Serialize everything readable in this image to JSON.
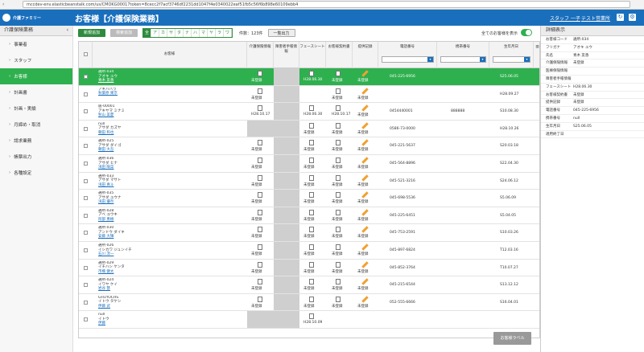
{
  "browser": {
    "url": "mccdev-env.elasticbeanstalk.com/us/CMOKG00017token=8cecc2f7acf3746df2231dd1047f4e0340022eaf51fb5c56f6b898e60109ebb4"
  },
  "header": {
    "logo_text": "介護ファミリー",
    "title": "お客様【介護保険業務】",
    "user": "スタッフ 一子",
    "store": "テスト営業所"
  },
  "sidebar": {
    "title": "介護保険業務",
    "items": [
      {
        "label": "事業者",
        "active": false
      },
      {
        "label": "スタッフ",
        "active": false
      },
      {
        "label": "お客様",
        "active": true
      },
      {
        "label": "計画書",
        "active": false
      },
      {
        "label": "計画・実績",
        "active": false
      },
      {
        "label": "月締め・取消",
        "active": false
      },
      {
        "label": "請求業務",
        "active": false
      },
      {
        "label": "帳票出力",
        "active": false
      },
      {
        "label": "各種設定",
        "active": false
      }
    ]
  },
  "toolbar": {
    "new_label": "新規追加",
    "add_label": "検索追加",
    "kana": [
      "全",
      "ア",
      "カ",
      "サ",
      "タ",
      "ナ",
      "ハ",
      "マ",
      "ヤ",
      "ラ",
      "ワ"
    ],
    "count": "件数：123件",
    "list_label": "一覧出力",
    "all_toggle_label": "全てのお客様を表示"
  },
  "columns": {
    "name": "お客様",
    "care_info": "介護保険情報",
    "welfare": "障害者手帳情報",
    "facesheet": "フェースシート",
    "contract": "お客様契約書",
    "proc": "提供記録",
    "phone": "電話番号",
    "mobile": "携帯番号",
    "birth": "生年月日",
    "end": "適用終了日"
  },
  "rows": [
    {
      "id": "通所-034",
      "kana": "アオキ ユウ",
      "name": "青木 友香",
      "care": "未登録",
      "fs": "H28.06.30",
      "ct": "未登録",
      "pr": "未登録",
      "phone": "045-225-6956",
      "mobile": "",
      "birth": "S25.06.05",
      "hl": true
    },
    {
      "id": "",
      "kana": "アキハバラ",
      "name": "秋葉原 東京",
      "care": "未登録",
      "fs": "",
      "ct": "未登録",
      "pr": "未登録",
      "phone": "",
      "mobile": "",
      "birth": "H28.09.27",
      "hl": false
    },
    {
      "id": "居-00001",
      "kana": "アキヤマ ミナミ",
      "name": "秋山 美夏",
      "care": "H28.10.17",
      "fs": "H28.06.30",
      "ct": "H28.10.17",
      "pr": "未登録",
      "phone": "0454440001",
      "mobile": "888888",
      "birth": "S10.08.30",
      "hl": false
    },
    {
      "id": "null",
      "kana": "アサダ カズヤ",
      "name": "朝田 和也",
      "care": "",
      "fs": "未登録",
      "ct": "未登録",
      "pr": "未登録",
      "phone": "0586-73-0000",
      "mobile": "",
      "birth": "H28.10.26",
      "hl": false
    },
    {
      "id": "通所-025",
      "kana": "アサダ ダイゴ",
      "name": "朝田 大吾",
      "care": "未登録",
      "fs": "未登録",
      "ct": "未登録",
      "pr": "未登録",
      "phone": "045-221-5637",
      "mobile": "",
      "birth": "S20.03.18",
      "hl": false
    },
    {
      "id": "通所-036",
      "kana": "アサダ ヒナ",
      "name": "浅田 陽菜",
      "care": "未登録",
      "fs": "未登録",
      "ct": "未登録",
      "pr": "未登録",
      "phone": "045-564-8896",
      "mobile": "",
      "birth": "S22.04.30",
      "hl": false
    },
    {
      "id": "通所-033",
      "kana": "アサダ マサト",
      "name": "浅田 真斗",
      "care": "未登録",
      "fs": "未登録",
      "ct": "未登録",
      "pr": "未登録",
      "phone": "045-521-3216",
      "mobile": "",
      "birth": "S24.06.12",
      "hl": false
    },
    {
      "id": "通所-035",
      "kana": "アサダ ユウナ",
      "name": "浅田 優奈",
      "care": "未登録",
      "fs": "未登録",
      "ct": "未登録",
      "pr": "未登録",
      "phone": "045-698-5536",
      "mobile": "",
      "birth": "S5.06.09",
      "hl": false
    },
    {
      "id": "通所-028",
      "kana": "アベ ユウキ",
      "name": "阿部 勇樹",
      "care": "未登録",
      "fs": "未登録",
      "ct": "未登録",
      "pr": "未登録",
      "phone": "045-225-6451",
      "mobile": "",
      "birth": "S5.04.05",
      "hl": false
    },
    {
      "id": "通所-030",
      "kana": "アンドウ ダイキ",
      "name": "安藤 大輝",
      "care": "未登録",
      "fs": "未登録",
      "ct": "未登録",
      "pr": "未登録",
      "phone": "045-753-2591",
      "mobile": "",
      "birth": "S10.03.26",
      "hl": false
    },
    {
      "id": "通所-026",
      "kana": "イシカワ ジュンイチ",
      "name": "石川 淳一",
      "care": "未登録",
      "fs": "未登録",
      "ct": "未登録",
      "pr": "未登録",
      "phone": "045-897-6824",
      "mobile": "",
      "birth": "T12.03.16",
      "hl": false
    },
    {
      "id": "通所-029",
      "kana": "イチハシ ケンタ",
      "name": "市橋 健太",
      "care": "未登録",
      "fs": "未登録",
      "ct": "未登録",
      "pr": "未登録",
      "phone": "045-852-3764",
      "mobile": "",
      "birth": "T10.07.27",
      "hl": false
    },
    {
      "id": "通所-024",
      "kana": "イワヤ ケイ",
      "name": "岩谷 慧",
      "care": "未登録",
      "fs": "未登録",
      "ct": "未登録",
      "pr": "未登録",
      "phone": "045-215-6544",
      "mobile": "",
      "birth": "S13.12.12",
      "hl": false
    },
    {
      "id": "GH1YOCHS",
      "kana": "イトウ タケシ",
      "name": "伊藤 武",
      "care": "未登録",
      "fs": "未登録",
      "ct": "未登録",
      "pr": "未登録",
      "phone": "052-555-6666",
      "mobile": "",
      "birth": "S16.04.01",
      "hl": false
    },
    {
      "id": "null",
      "kana": "イトウ",
      "name": "伊藤",
      "care": "",
      "fs": "H28.10.09",
      "ct": "",
      "pr": "",
      "phone": "",
      "mobile": "",
      "birth": "",
      "hl": false
    }
  ],
  "care_button": "お客様ラベル",
  "detail": {
    "title": "詳細表示",
    "fields": [
      {
        "k": "お客様コード",
        "v": "通所-034"
      },
      {
        "k": "フリガナ",
        "v": "アオキ ユウ"
      },
      {
        "k": "氏名",
        "v": "青木 友香"
      },
      {
        "k": "介護保険情報",
        "v": "未登録"
      },
      {
        "k": "医療保険情報",
        "v": ""
      },
      {
        "k": "障害者手帳情報",
        "v": ""
      },
      {
        "k": "フェースシート",
        "v": "H28.06.30"
      },
      {
        "k": "お客様契約書",
        "v": "未登録"
      },
      {
        "k": "提供記録",
        "v": "未登録"
      },
      {
        "k": "電話番号",
        "v": "045-225-6956"
      },
      {
        "k": "携帯番号",
        "v": "null"
      },
      {
        "k": "生年月日",
        "v": "S25.06.05"
      },
      {
        "k": "適用終了日",
        "v": ""
      }
    ]
  }
}
